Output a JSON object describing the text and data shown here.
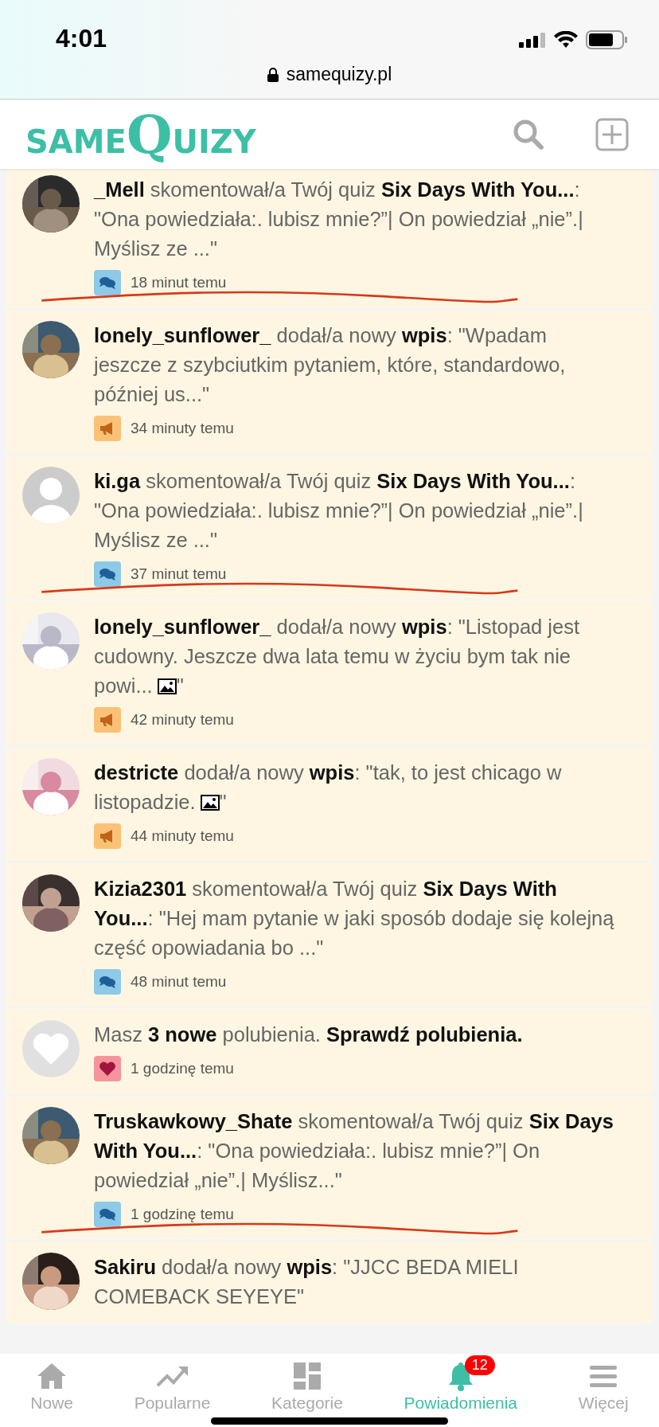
{
  "status_bar": {
    "time": "4:01"
  },
  "address_bar": {
    "url": "samequizy.pl"
  },
  "header": {
    "logo_left": "SAME",
    "logo_big": "Q",
    "logo_right": "UIZY"
  },
  "notifications": [
    {
      "badge": {
        "kind": "comment"
      },
      "text": "**_Mell** skomentował/a Twój quiz **Six Days With You...**: \"Ona powiedziała:. lubisz mnie?”| On powiedział „nie”.| Myślisz ze ...\"",
      "time": "18 minut temu",
      "underlined": true
    },
    {
      "badge": {
        "kind": "post"
      },
      "text": "**lonely_sunflower_** dodał/a nowy **wpis**: \"Wpadam jeszcze z szybciutkim pytaniem, które, standardowo, później us...\"",
      "time": "34 minuty temu",
      "underlined": false
    },
    {
      "avatar": {
        "kind": "person"
      },
      "badge": {
        "kind": "comment"
      },
      "text": "**ki.ga** skomentował/a Twój quiz **Six Days With You...**: \"Ona powiedziała:. lubisz mnie?”| On powiedział „nie”.| Myślisz ze ...\"",
      "time": "37 minut temu",
      "underlined": true
    },
    {
      "badge": {
        "kind": "post"
      },
      "text": "**lonely_sunflower_** dodał/a nowy **wpis**: \"Listopad jest cudowny. Jeszcze dwa lata temu w życiu bym tak nie powi...",
      "image": true,
      "text_after": "\"",
      "time": "42 minuty temu",
      "underlined": false
    },
    {
      "badge": {
        "kind": "post"
      },
      "text": "**destricte** dodał/a nowy **wpis**: \"tak, to jest chicago w listopadzie.",
      "image": true,
      "text_after": "\"",
      "time": "44 minuty temu",
      "underlined": false
    },
    {
      "badge": {
        "kind": "comment"
      },
      "text": "**Kizia2301** skomentował/a Twój quiz **Six Days With You...**: \"Hej mam pytanie w jaki sposób dodaje się kolejną część opowiadania bo ...\"",
      "time": "48 minut temu",
      "underlined": false
    },
    {
      "avatar": {
        "kind": "heart"
      },
      "badge": {
        "kind": "like"
      },
      "text": "Masz **3 nowe** polubienia. **Sprawdź polubienia.**",
      "time": "1 godzinę temu",
      "underlined": false
    },
    {
      "badge": {
        "kind": "comment"
      },
      "text": "**Truskawkowy_Shate** skomentował/a Twój quiz **Six Days With You...**: \"Ona powiedziała:. lubisz mnie?”| On powiedział „nie”.| Myślisz...\"",
      "time": "1 godzinę temu",
      "underlined": true
    },
    {
      "text": "**Sakiru** dodał/a nowy **wpis**: \"JJCC BEDA MIELI COMEBACK SEYEYE\""
    }
  ],
  "tab_bar": [
    {
      "kind": "home",
      "label": "Nowe",
      "selected": false
    },
    {
      "kind": "trend",
      "label": "Popularne",
      "selected": false
    },
    {
      "kind": "grid",
      "label": "Kategorie",
      "selected": false
    },
    {
      "kind": "bell",
      "label": "Powiadomienia",
      "selected": true,
      "count": "12"
    },
    {
      "kind": "menu",
      "label": "Więcej",
      "selected": false
    }
  ]
}
